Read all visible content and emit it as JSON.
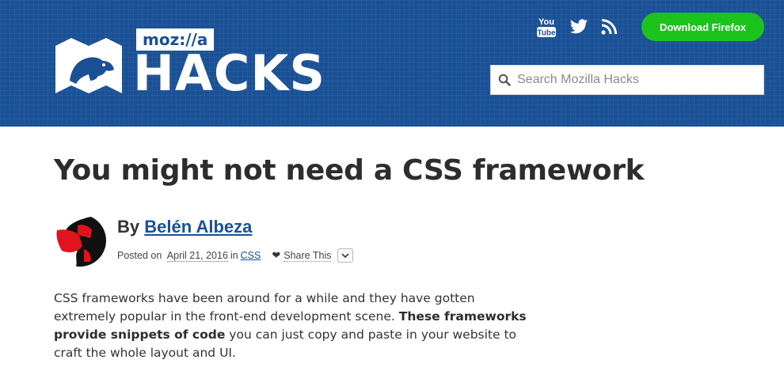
{
  "header": {
    "logo": {
      "tag": "moz://a",
      "wordmark": "HACKS"
    },
    "social": [
      "youtube-icon",
      "twitter-icon",
      "rss-icon"
    ],
    "download_label": "Download Firefox",
    "search": {
      "placeholder": "Search Mozilla Hacks",
      "value": ""
    }
  },
  "article": {
    "title": "You might not need a CSS framework",
    "byline": {
      "prefix": "By ",
      "author": "Belén Albeza"
    },
    "meta": {
      "posted_on": "Posted on",
      "date": "April 21, 2016",
      "in_label": "in",
      "category": "CSS",
      "share_label": "Share This"
    },
    "intro": {
      "part1": "CSS frameworks have been around for a while and they have gotten extremely popular in the front-end development scene. ",
      "bold": "These frameworks provide snippets of code",
      "part2": " you can just copy and paste in your website to craft the whole layout and UI."
    }
  },
  "colors": {
    "header_bg": "#1a5196",
    "download_btn": "#1dc31d",
    "link": "#1a5196",
    "title": "#2d2d2d"
  }
}
